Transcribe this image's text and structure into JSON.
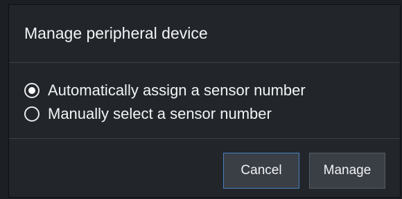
{
  "dialog": {
    "title": "Manage peripheral device",
    "options": [
      {
        "label": "Automatically assign a sensor number",
        "selected": true
      },
      {
        "label": "Manually select a sensor number",
        "selected": false
      }
    ],
    "buttons": {
      "cancel_label": "Cancel",
      "manage_label": "Manage"
    }
  },
  "colors": {
    "dialog_bg": "#22262b",
    "text": "#f2f3f4",
    "focus_border": "#4a7fc0"
  }
}
